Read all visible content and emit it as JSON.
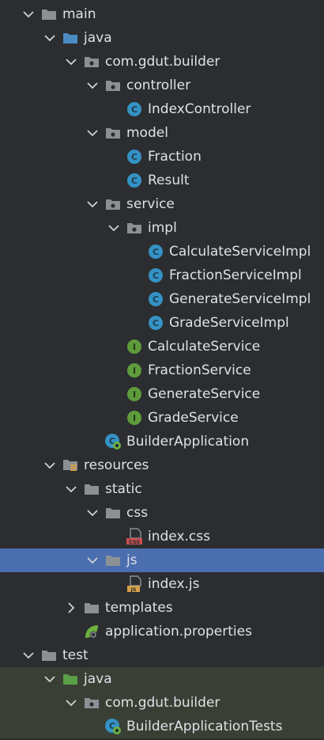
{
  "colors": {
    "background": "#2b2d30",
    "selected_row": "#4b6eaf",
    "test_zone": "#3a3f35",
    "folder": "#8c9095",
    "source_folder": "#4a8bc4",
    "test_folder": "#5a9e45",
    "class_badge": "#3592c4",
    "interface_badge": "#5e9c3b",
    "text": "#dfe1e5"
  },
  "tree": [
    {
      "label": "main",
      "depth": 1,
      "chevron": "down",
      "icon": "folder",
      "name": "tree-item-main"
    },
    {
      "label": "java",
      "depth": 2,
      "chevron": "down",
      "icon": "source-folder",
      "name": "tree-item-java"
    },
    {
      "label": "com.gdut.builder",
      "depth": 3,
      "chevron": "down",
      "icon": "package",
      "name": "tree-item-com-gdut-builder"
    },
    {
      "label": "controller",
      "depth": 4,
      "chevron": "down",
      "icon": "package",
      "name": "tree-item-controller"
    },
    {
      "label": "IndexController",
      "depth": 5,
      "chevron": "none",
      "icon": "class",
      "name": "tree-item-indexcontroller"
    },
    {
      "label": "model",
      "depth": 4,
      "chevron": "down",
      "icon": "package",
      "name": "tree-item-model"
    },
    {
      "label": "Fraction",
      "depth": 5,
      "chevron": "none",
      "icon": "class",
      "name": "tree-item-fraction"
    },
    {
      "label": "Result",
      "depth": 5,
      "chevron": "none",
      "icon": "class",
      "name": "tree-item-result"
    },
    {
      "label": "service",
      "depth": 4,
      "chevron": "down",
      "icon": "package",
      "name": "tree-item-service"
    },
    {
      "label": "impl",
      "depth": 5,
      "chevron": "down",
      "icon": "package",
      "name": "tree-item-impl"
    },
    {
      "label": "CalculateServiceImpl",
      "depth": 6,
      "chevron": "none",
      "icon": "class",
      "name": "tree-item-calculateserviceimpl"
    },
    {
      "label": "FractionServiceImpl",
      "depth": 6,
      "chevron": "none",
      "icon": "class",
      "name": "tree-item-fractionserviceimpl"
    },
    {
      "label": "GenerateServiceImpl",
      "depth": 6,
      "chevron": "none",
      "icon": "class",
      "name": "tree-item-generateserviceimpl"
    },
    {
      "label": "GradeServiceImpl",
      "depth": 6,
      "chevron": "none",
      "icon": "class",
      "name": "tree-item-gradeserviceimpl"
    },
    {
      "label": "CalculateService",
      "depth": 5,
      "chevron": "none",
      "icon": "interface",
      "name": "tree-item-calculateservice"
    },
    {
      "label": "FractionService",
      "depth": 5,
      "chevron": "none",
      "icon": "interface",
      "name": "tree-item-fractionservice"
    },
    {
      "label": "GenerateService",
      "depth": 5,
      "chevron": "none",
      "icon": "interface",
      "name": "tree-item-generateservice"
    },
    {
      "label": "GradeService",
      "depth": 5,
      "chevron": "none",
      "icon": "interface",
      "name": "tree-item-gradeservice"
    },
    {
      "label": "BuilderApplication",
      "depth": 4,
      "chevron": "none",
      "icon": "spring-class",
      "name": "tree-item-builderapplication"
    },
    {
      "label": "resources",
      "depth": 2,
      "chevron": "down",
      "icon": "resources-folder",
      "name": "tree-item-resources"
    },
    {
      "label": "static",
      "depth": 3,
      "chevron": "down",
      "icon": "folder",
      "name": "tree-item-static"
    },
    {
      "label": "css",
      "depth": 4,
      "chevron": "down",
      "icon": "folder",
      "name": "tree-item-css"
    },
    {
      "label": "index.css",
      "depth": 5,
      "chevron": "none",
      "icon": "css-file",
      "name": "tree-item-index-css"
    },
    {
      "label": "js",
      "depth": 4,
      "chevron": "down",
      "icon": "folder",
      "name": "tree-item-js",
      "selected": true
    },
    {
      "label": "index.js",
      "depth": 5,
      "chevron": "none",
      "icon": "js-file",
      "name": "tree-item-index-js"
    },
    {
      "label": "templates",
      "depth": 3,
      "chevron": "right",
      "icon": "folder",
      "name": "tree-item-templates"
    },
    {
      "label": "application.properties",
      "depth": 3,
      "chevron": "none",
      "icon": "spring-properties",
      "name": "tree-item-application-properties"
    },
    {
      "label": "test",
      "depth": 1,
      "chevron": "down",
      "icon": "folder",
      "name": "tree-item-test"
    },
    {
      "label": "java",
      "depth": 2,
      "chevron": "down",
      "icon": "test-folder",
      "name": "tree-item-test-java",
      "test_zone": true
    },
    {
      "label": "com.gdut.builder",
      "depth": 3,
      "chevron": "down",
      "icon": "package",
      "name": "tree-item-test-com-gdut-builder",
      "test_zone": true
    },
    {
      "label": "BuilderApplicationTests",
      "depth": 4,
      "chevron": "none",
      "icon": "spring-class",
      "name": "tree-item-builderapplicationtests",
      "test_zone": true
    }
  ]
}
